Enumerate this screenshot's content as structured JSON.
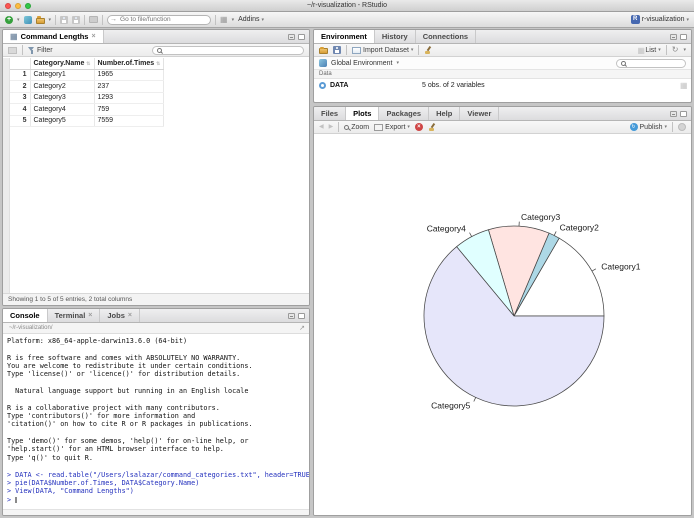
{
  "window": {
    "title": "~/r-visualization - RStudio"
  },
  "main_toolbar": {
    "goto_placeholder": "Go to file/function",
    "addins_label": "Addins",
    "project_label": "r-visualization"
  },
  "source_pane": {
    "tab_label": "Command Lengths",
    "filter_label": "Filter",
    "table": {
      "columns": [
        "Category.Name",
        "Number.of.Times"
      ],
      "rows": [
        [
          "1",
          "Category1",
          "1965"
        ],
        [
          "2",
          "Category2",
          "237"
        ],
        [
          "3",
          "Category3",
          "1293"
        ],
        [
          "4",
          "Category4",
          "759"
        ],
        [
          "5",
          "Category5",
          "7559"
        ]
      ]
    },
    "footer": "Showing 1 to 5 of 5 entries, 2 total columns"
  },
  "console_pane": {
    "tabs": [
      "Console",
      "Terminal",
      "Jobs"
    ],
    "working_dir": "~/r-visualization/",
    "lines": [
      {
        "text": "Platform: x86_64-apple-darwin13.6.0 (64-bit)",
        "type": "output"
      },
      {
        "text": "",
        "type": "output"
      },
      {
        "text": "R is free software and comes with ABSOLUTELY NO WARRANTY.",
        "type": "output"
      },
      {
        "text": "You are welcome to redistribute it under certain conditions.",
        "type": "output"
      },
      {
        "text": "Type 'license()' or 'licence()' for distribution details.",
        "type": "output"
      },
      {
        "text": "",
        "type": "output"
      },
      {
        "text": "  Natural language support but running in an English locale",
        "type": "output"
      },
      {
        "text": "",
        "type": "output"
      },
      {
        "text": "R is a collaborative project with many contributors.",
        "type": "output"
      },
      {
        "text": "Type 'contributors()' for more information and",
        "type": "output"
      },
      {
        "text": "'citation()' on how to cite R or R packages in publications.",
        "type": "output"
      },
      {
        "text": "",
        "type": "output"
      },
      {
        "text": "Type 'demo()' for some demos, 'help()' for on-line help, or",
        "type": "output"
      },
      {
        "text": "'help.start()' for an HTML browser interface to help.",
        "type": "output"
      },
      {
        "text": "Type 'q()' to quit R.",
        "type": "output"
      },
      {
        "text": "",
        "type": "output"
      },
      {
        "text": "> DATA <- read.table(\"/Users/lsalazar/command_categories.txt\", header=TRUE)",
        "type": "input"
      },
      {
        "text": "> pie(DATA$Number.of.Times, DATA$Category.Name)",
        "type": "input"
      },
      {
        "text": "> View(DATA, \"Command Lengths\")",
        "type": "input"
      },
      {
        "text": "> ",
        "type": "prompt"
      }
    ]
  },
  "environment_pane": {
    "tabs": [
      "Environment",
      "History",
      "Connections"
    ],
    "import_dataset_label": "Import Dataset",
    "list_label": "List",
    "global_env_label": "Global Environment",
    "section_label": "Data",
    "objects": [
      {
        "name": "DATA",
        "summary": "5 obs. of 2 variables"
      }
    ]
  },
  "plots_pane": {
    "tabs": [
      "Files",
      "Plots",
      "Packages",
      "Help",
      "Viewer"
    ],
    "zoom_label": "Zoom",
    "export_label": "Export",
    "publish_label": "Publish"
  },
  "chart_data": {
    "type": "pie",
    "categories": [
      "Category1",
      "Category2",
      "Category3",
      "Category4",
      "Category5"
    ],
    "values": [
      1965,
      237,
      1293,
      759,
      7559
    ],
    "colors": [
      "#FFFFFF",
      "#ADD8E6",
      "#FFE4E1",
      "#E0FFFF",
      "#E6E6FA"
    ],
    "start_angle_deg": 0,
    "direction": "counterclockwise",
    "border_color": "#454545",
    "label_color": "#1a1a1a",
    "title": ""
  }
}
